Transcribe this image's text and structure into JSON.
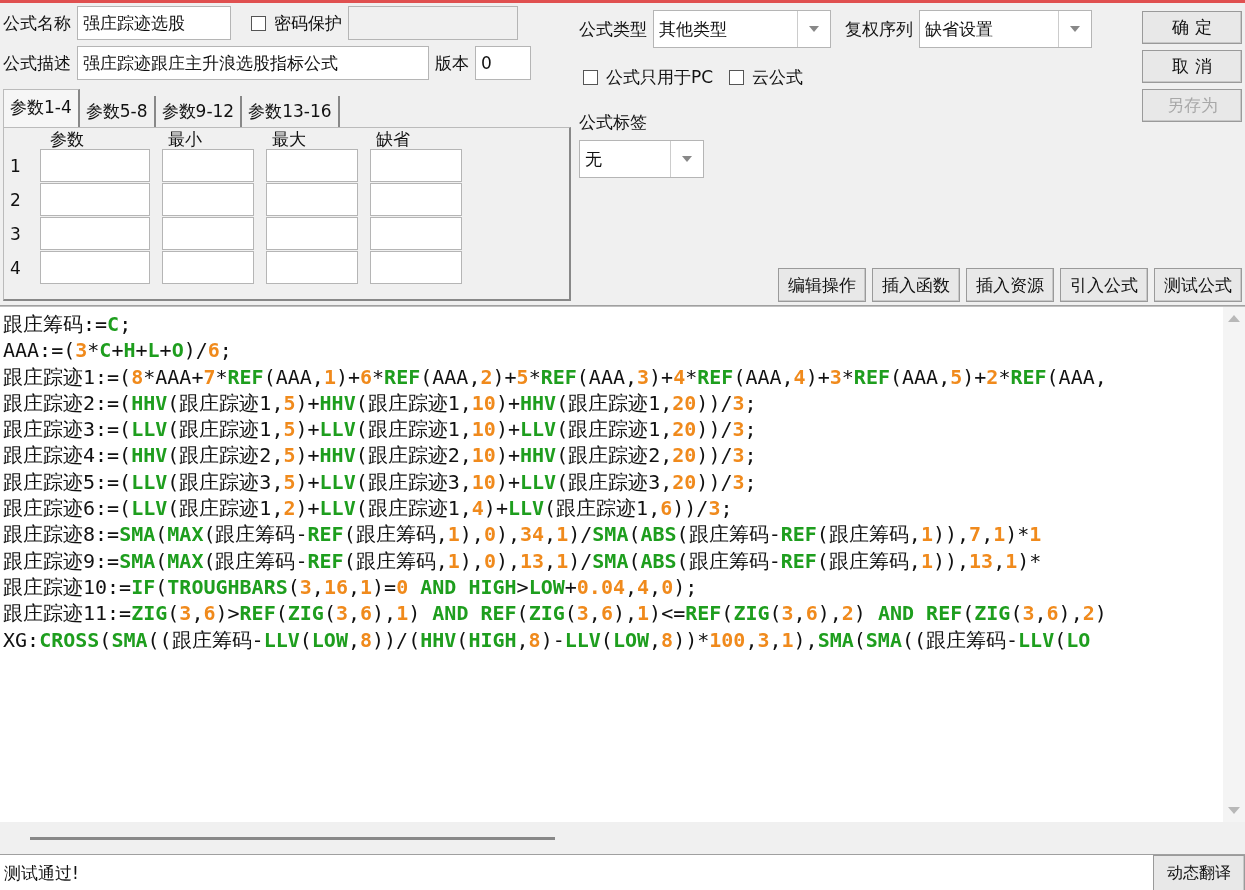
{
  "header": {
    "name": {
      "label": "公式名称",
      "value": "强庄踪迹选股"
    },
    "password": {
      "label": "密码保护",
      "checked": false
    },
    "description": {
      "label": "公式描述",
      "value": "强庄踪迹跟庄主升浪选股指标公式"
    },
    "version": {
      "label": "版本",
      "value": "0"
    },
    "formula_type": {
      "label": "公式类型",
      "value": "其他类型"
    },
    "adjust_series": {
      "label": "复权序列",
      "value": "缺省设置"
    },
    "pc_only": {
      "label": "公式只用于PC",
      "checked": false
    },
    "cloud": {
      "label": "云公式",
      "checked": false
    },
    "tag": {
      "label": "公式标签",
      "value": "无"
    }
  },
  "side_buttons": [
    {
      "label": "确 定",
      "disabled": false
    },
    {
      "label": "取 消",
      "disabled": false
    },
    {
      "label": "另存为",
      "disabled": true
    }
  ],
  "tabs": [
    {
      "label": "参数1-4",
      "selected": true
    },
    {
      "label": "参数5-8",
      "selected": false
    },
    {
      "label": "参数9-12",
      "selected": false
    },
    {
      "label": "参数13-16",
      "selected": false
    }
  ],
  "param_table": {
    "columns": [
      "参数",
      "最小",
      "最大",
      "缺省"
    ],
    "rows": [
      "1",
      "2",
      "3",
      "4"
    ]
  },
  "tool_buttons": [
    "编辑操作",
    "插入函数",
    "插入资源",
    "引入公式",
    "测试公式"
  ],
  "code_lines": [
    [
      {
        "kind": "plain",
        "text": "跟庄筹码:="
      },
      {
        "kind": "fn",
        "text": "C"
      },
      {
        "kind": "plain",
        "text": ";"
      }
    ],
    [
      {
        "kind": "plain",
        "text": "AAA:=("
      },
      {
        "kind": "num",
        "text": "3"
      },
      {
        "kind": "plain",
        "text": "*"
      },
      {
        "kind": "fn",
        "text": "C"
      },
      {
        "kind": "plain",
        "text": "+"
      },
      {
        "kind": "fn",
        "text": "H"
      },
      {
        "kind": "plain",
        "text": "+"
      },
      {
        "kind": "fn",
        "text": "L"
      },
      {
        "kind": "plain",
        "text": "+"
      },
      {
        "kind": "fn",
        "text": "O"
      },
      {
        "kind": "plain",
        "text": ")/"
      },
      {
        "kind": "num",
        "text": "6"
      },
      {
        "kind": "plain",
        "text": ";"
      }
    ],
    [
      {
        "kind": "plain",
        "text": "跟庄踪迹1:=("
      },
      {
        "kind": "num",
        "text": "8"
      },
      {
        "kind": "plain",
        "text": "*AAA+"
      },
      {
        "kind": "num",
        "text": "7"
      },
      {
        "kind": "plain",
        "text": "*"
      },
      {
        "kind": "fn",
        "text": "REF"
      },
      {
        "kind": "plain",
        "text": "(AAA,"
      },
      {
        "kind": "num",
        "text": "1"
      },
      {
        "kind": "plain",
        "text": ")+"
      },
      {
        "kind": "num",
        "text": "6"
      },
      {
        "kind": "plain",
        "text": "*"
      },
      {
        "kind": "fn",
        "text": "REF"
      },
      {
        "kind": "plain",
        "text": "(AAA,"
      },
      {
        "kind": "num",
        "text": "2"
      },
      {
        "kind": "plain",
        "text": ")+"
      },
      {
        "kind": "num",
        "text": "5"
      },
      {
        "kind": "plain",
        "text": "*"
      },
      {
        "kind": "fn",
        "text": "REF"
      },
      {
        "kind": "plain",
        "text": "(AAA,"
      },
      {
        "kind": "num",
        "text": "3"
      },
      {
        "kind": "plain",
        "text": ")+"
      },
      {
        "kind": "num",
        "text": "4"
      },
      {
        "kind": "plain",
        "text": "*"
      },
      {
        "kind": "fn",
        "text": "REF"
      },
      {
        "kind": "plain",
        "text": "(AAA,"
      },
      {
        "kind": "num",
        "text": "4"
      },
      {
        "kind": "plain",
        "text": ")+"
      },
      {
        "kind": "num",
        "text": "3"
      },
      {
        "kind": "plain",
        "text": "*"
      },
      {
        "kind": "fn",
        "text": "REF"
      },
      {
        "kind": "plain",
        "text": "(AAA,"
      },
      {
        "kind": "num",
        "text": "5"
      },
      {
        "kind": "plain",
        "text": ")+"
      },
      {
        "kind": "num",
        "text": "2"
      },
      {
        "kind": "plain",
        "text": "*"
      },
      {
        "kind": "fn",
        "text": "REF"
      },
      {
        "kind": "plain",
        "text": "(AAA,"
      }
    ],
    [
      {
        "kind": "plain",
        "text": "跟庄踪迹2:=("
      },
      {
        "kind": "fn",
        "text": "HHV"
      },
      {
        "kind": "plain",
        "text": "(跟庄踪迹1,"
      },
      {
        "kind": "num",
        "text": "5"
      },
      {
        "kind": "plain",
        "text": ")+"
      },
      {
        "kind": "fn",
        "text": "HHV"
      },
      {
        "kind": "plain",
        "text": "(跟庄踪迹1,"
      },
      {
        "kind": "num",
        "text": "10"
      },
      {
        "kind": "plain",
        "text": ")+"
      },
      {
        "kind": "fn",
        "text": "HHV"
      },
      {
        "kind": "plain",
        "text": "(跟庄踪迹1,"
      },
      {
        "kind": "num",
        "text": "20"
      },
      {
        "kind": "plain",
        "text": "))/"
      },
      {
        "kind": "num",
        "text": "3"
      },
      {
        "kind": "plain",
        "text": ";"
      }
    ],
    [
      {
        "kind": "plain",
        "text": "跟庄踪迹3:=("
      },
      {
        "kind": "fn",
        "text": "LLV"
      },
      {
        "kind": "plain",
        "text": "(跟庄踪迹1,"
      },
      {
        "kind": "num",
        "text": "5"
      },
      {
        "kind": "plain",
        "text": ")+"
      },
      {
        "kind": "fn",
        "text": "LLV"
      },
      {
        "kind": "plain",
        "text": "(跟庄踪迹1,"
      },
      {
        "kind": "num",
        "text": "10"
      },
      {
        "kind": "plain",
        "text": ")+"
      },
      {
        "kind": "fn",
        "text": "LLV"
      },
      {
        "kind": "plain",
        "text": "(跟庄踪迹1,"
      },
      {
        "kind": "num",
        "text": "20"
      },
      {
        "kind": "plain",
        "text": "))/"
      },
      {
        "kind": "num",
        "text": "3"
      },
      {
        "kind": "plain",
        "text": ";"
      }
    ],
    [
      {
        "kind": "plain",
        "text": "跟庄踪迹4:=("
      },
      {
        "kind": "fn",
        "text": "HHV"
      },
      {
        "kind": "plain",
        "text": "(跟庄踪迹2,"
      },
      {
        "kind": "num",
        "text": "5"
      },
      {
        "kind": "plain",
        "text": ")+"
      },
      {
        "kind": "fn",
        "text": "HHV"
      },
      {
        "kind": "plain",
        "text": "(跟庄踪迹2,"
      },
      {
        "kind": "num",
        "text": "10"
      },
      {
        "kind": "plain",
        "text": ")+"
      },
      {
        "kind": "fn",
        "text": "HHV"
      },
      {
        "kind": "plain",
        "text": "(跟庄踪迹2,"
      },
      {
        "kind": "num",
        "text": "20"
      },
      {
        "kind": "plain",
        "text": "))/"
      },
      {
        "kind": "num",
        "text": "3"
      },
      {
        "kind": "plain",
        "text": ";"
      }
    ],
    [
      {
        "kind": "plain",
        "text": "跟庄踪迹5:=("
      },
      {
        "kind": "fn",
        "text": "LLV"
      },
      {
        "kind": "plain",
        "text": "(跟庄踪迹3,"
      },
      {
        "kind": "num",
        "text": "5"
      },
      {
        "kind": "plain",
        "text": ")+"
      },
      {
        "kind": "fn",
        "text": "LLV"
      },
      {
        "kind": "plain",
        "text": "(跟庄踪迹3,"
      },
      {
        "kind": "num",
        "text": "10"
      },
      {
        "kind": "plain",
        "text": ")+"
      },
      {
        "kind": "fn",
        "text": "LLV"
      },
      {
        "kind": "plain",
        "text": "(跟庄踪迹3,"
      },
      {
        "kind": "num",
        "text": "20"
      },
      {
        "kind": "plain",
        "text": "))/"
      },
      {
        "kind": "num",
        "text": "3"
      },
      {
        "kind": "plain",
        "text": ";"
      }
    ],
    [
      {
        "kind": "plain",
        "text": "跟庄踪迹6:=("
      },
      {
        "kind": "fn",
        "text": "LLV"
      },
      {
        "kind": "plain",
        "text": "(跟庄踪迹1,"
      },
      {
        "kind": "num",
        "text": "2"
      },
      {
        "kind": "plain",
        "text": ")+"
      },
      {
        "kind": "fn",
        "text": "LLV"
      },
      {
        "kind": "plain",
        "text": "(跟庄踪迹1,"
      },
      {
        "kind": "num",
        "text": "4"
      },
      {
        "kind": "plain",
        "text": ")+"
      },
      {
        "kind": "fn",
        "text": "LLV"
      },
      {
        "kind": "plain",
        "text": "(跟庄踪迹1,"
      },
      {
        "kind": "num",
        "text": "6"
      },
      {
        "kind": "plain",
        "text": "))/"
      },
      {
        "kind": "num",
        "text": "3"
      },
      {
        "kind": "plain",
        "text": ";"
      }
    ],
    [
      {
        "kind": "plain",
        "text": "跟庄踪迹8:="
      },
      {
        "kind": "fn",
        "text": "SMA"
      },
      {
        "kind": "plain",
        "text": "("
      },
      {
        "kind": "fn",
        "text": "MAX"
      },
      {
        "kind": "plain",
        "text": "(跟庄筹码-"
      },
      {
        "kind": "fn",
        "text": "REF"
      },
      {
        "kind": "plain",
        "text": "(跟庄筹码,"
      },
      {
        "kind": "num",
        "text": "1"
      },
      {
        "kind": "plain",
        "text": "),"
      },
      {
        "kind": "num",
        "text": "0"
      },
      {
        "kind": "plain",
        "text": "),"
      },
      {
        "kind": "num",
        "text": "34"
      },
      {
        "kind": "plain",
        "text": ","
      },
      {
        "kind": "num",
        "text": "1"
      },
      {
        "kind": "plain",
        "text": ")/"
      },
      {
        "kind": "fn",
        "text": "SMA"
      },
      {
        "kind": "plain",
        "text": "("
      },
      {
        "kind": "fn",
        "text": "ABS"
      },
      {
        "kind": "plain",
        "text": "(跟庄筹码-"
      },
      {
        "kind": "fn",
        "text": "REF"
      },
      {
        "kind": "plain",
        "text": "(跟庄筹码,"
      },
      {
        "kind": "num",
        "text": "1"
      },
      {
        "kind": "plain",
        "text": ")),"
      },
      {
        "kind": "num",
        "text": "7"
      },
      {
        "kind": "plain",
        "text": ","
      },
      {
        "kind": "num",
        "text": "1"
      },
      {
        "kind": "plain",
        "text": ")*"
      },
      {
        "kind": "num",
        "text": "1"
      }
    ],
    [
      {
        "kind": "plain",
        "text": "跟庄踪迹9:="
      },
      {
        "kind": "fn",
        "text": "SMA"
      },
      {
        "kind": "plain",
        "text": "("
      },
      {
        "kind": "fn",
        "text": "MAX"
      },
      {
        "kind": "plain",
        "text": "(跟庄筹码-"
      },
      {
        "kind": "fn",
        "text": "REF"
      },
      {
        "kind": "plain",
        "text": "(跟庄筹码,"
      },
      {
        "kind": "num",
        "text": "1"
      },
      {
        "kind": "plain",
        "text": "),"
      },
      {
        "kind": "num",
        "text": "0"
      },
      {
        "kind": "plain",
        "text": "),"
      },
      {
        "kind": "num",
        "text": "13"
      },
      {
        "kind": "plain",
        "text": ","
      },
      {
        "kind": "num",
        "text": "1"
      },
      {
        "kind": "plain",
        "text": ")/"
      },
      {
        "kind": "fn",
        "text": "SMA"
      },
      {
        "kind": "plain",
        "text": "("
      },
      {
        "kind": "fn",
        "text": "ABS"
      },
      {
        "kind": "plain",
        "text": "(跟庄筹码-"
      },
      {
        "kind": "fn",
        "text": "REF"
      },
      {
        "kind": "plain",
        "text": "(跟庄筹码,"
      },
      {
        "kind": "num",
        "text": "1"
      },
      {
        "kind": "plain",
        "text": ")),"
      },
      {
        "kind": "num",
        "text": "13"
      },
      {
        "kind": "plain",
        "text": ","
      },
      {
        "kind": "num",
        "text": "1"
      },
      {
        "kind": "plain",
        "text": ")*"
      }
    ],
    [
      {
        "kind": "plain",
        "text": "跟庄踪迹10:="
      },
      {
        "kind": "fn",
        "text": "IF"
      },
      {
        "kind": "plain",
        "text": "("
      },
      {
        "kind": "fn",
        "text": "TROUGHBARS"
      },
      {
        "kind": "plain",
        "text": "("
      },
      {
        "kind": "num",
        "text": "3"
      },
      {
        "kind": "plain",
        "text": ","
      },
      {
        "kind": "num",
        "text": "16"
      },
      {
        "kind": "plain",
        "text": ","
      },
      {
        "kind": "num",
        "text": "1"
      },
      {
        "kind": "plain",
        "text": ")="
      },
      {
        "kind": "num",
        "text": "0"
      },
      {
        "kind": "fn",
        "text": " AND "
      },
      {
        "kind": "fn",
        "text": "HIGH"
      },
      {
        "kind": "plain",
        "text": ">"
      },
      {
        "kind": "fn",
        "text": "LOW"
      },
      {
        "kind": "plain",
        "text": "+"
      },
      {
        "kind": "num",
        "text": "0.04"
      },
      {
        "kind": "plain",
        "text": ","
      },
      {
        "kind": "num",
        "text": "4"
      },
      {
        "kind": "plain",
        "text": ","
      },
      {
        "kind": "num",
        "text": "0"
      },
      {
        "kind": "plain",
        "text": ");"
      }
    ],
    [
      {
        "kind": "plain",
        "text": "跟庄踪迹11:="
      },
      {
        "kind": "fn",
        "text": "ZIG"
      },
      {
        "kind": "plain",
        "text": "("
      },
      {
        "kind": "num",
        "text": "3"
      },
      {
        "kind": "plain",
        "text": ","
      },
      {
        "kind": "num",
        "text": "6"
      },
      {
        "kind": "plain",
        "text": ")>"
      },
      {
        "kind": "fn",
        "text": "REF"
      },
      {
        "kind": "plain",
        "text": "("
      },
      {
        "kind": "fn",
        "text": "ZIG"
      },
      {
        "kind": "plain",
        "text": "("
      },
      {
        "kind": "num",
        "text": "3"
      },
      {
        "kind": "plain",
        "text": ","
      },
      {
        "kind": "num",
        "text": "6"
      },
      {
        "kind": "plain",
        "text": "),"
      },
      {
        "kind": "num",
        "text": "1"
      },
      {
        "kind": "plain",
        "text": ") "
      },
      {
        "kind": "fn",
        "text": "AND "
      },
      {
        "kind": "fn",
        "text": "REF"
      },
      {
        "kind": "plain",
        "text": "("
      },
      {
        "kind": "fn",
        "text": "ZIG"
      },
      {
        "kind": "plain",
        "text": "("
      },
      {
        "kind": "num",
        "text": "3"
      },
      {
        "kind": "plain",
        "text": ","
      },
      {
        "kind": "num",
        "text": "6"
      },
      {
        "kind": "plain",
        "text": "),"
      },
      {
        "kind": "num",
        "text": "1"
      },
      {
        "kind": "plain",
        "text": ")<="
      },
      {
        "kind": "fn",
        "text": "REF"
      },
      {
        "kind": "plain",
        "text": "("
      },
      {
        "kind": "fn",
        "text": "ZIG"
      },
      {
        "kind": "plain",
        "text": "("
      },
      {
        "kind": "num",
        "text": "3"
      },
      {
        "kind": "plain",
        "text": ","
      },
      {
        "kind": "num",
        "text": "6"
      },
      {
        "kind": "plain",
        "text": "),"
      },
      {
        "kind": "num",
        "text": "2"
      },
      {
        "kind": "plain",
        "text": ") "
      },
      {
        "kind": "fn",
        "text": "AND "
      },
      {
        "kind": "fn",
        "text": "REF"
      },
      {
        "kind": "plain",
        "text": "("
      },
      {
        "kind": "fn",
        "text": "ZIG"
      },
      {
        "kind": "plain",
        "text": "("
      },
      {
        "kind": "num",
        "text": "3"
      },
      {
        "kind": "plain",
        "text": ","
      },
      {
        "kind": "num",
        "text": "6"
      },
      {
        "kind": "plain",
        "text": "),"
      },
      {
        "kind": "num",
        "text": "2"
      },
      {
        "kind": "plain",
        "text": ")"
      }
    ],
    [
      {
        "kind": "plain",
        "text": "XG:"
      },
      {
        "kind": "fn",
        "text": "CROSS"
      },
      {
        "kind": "plain",
        "text": "("
      },
      {
        "kind": "fn",
        "text": "SMA"
      },
      {
        "kind": "plain",
        "text": "((跟庄筹码-"
      },
      {
        "kind": "fn",
        "text": "LLV"
      },
      {
        "kind": "plain",
        "text": "("
      },
      {
        "kind": "fn",
        "text": "LOW"
      },
      {
        "kind": "plain",
        "text": ","
      },
      {
        "kind": "num",
        "text": "8"
      },
      {
        "kind": "plain",
        "text": "))/("
      },
      {
        "kind": "fn",
        "text": "HHV"
      },
      {
        "kind": "plain",
        "text": "("
      },
      {
        "kind": "fn",
        "text": "HIGH"
      },
      {
        "kind": "plain",
        "text": ","
      },
      {
        "kind": "num",
        "text": "8"
      },
      {
        "kind": "plain",
        "text": ")-"
      },
      {
        "kind": "fn",
        "text": "LLV"
      },
      {
        "kind": "plain",
        "text": "("
      },
      {
        "kind": "fn",
        "text": "LOW"
      },
      {
        "kind": "plain",
        "text": ","
      },
      {
        "kind": "num",
        "text": "8"
      },
      {
        "kind": "plain",
        "text": "))*"
      },
      {
        "kind": "num",
        "text": "100"
      },
      {
        "kind": "plain",
        "text": ","
      },
      {
        "kind": "num",
        "text": "3"
      },
      {
        "kind": "plain",
        "text": ","
      },
      {
        "kind": "num",
        "text": "1"
      },
      {
        "kind": "plain",
        "text": "),"
      },
      {
        "kind": "fn",
        "text": "SMA"
      },
      {
        "kind": "plain",
        "text": "("
      },
      {
        "kind": "fn",
        "text": "SMA"
      },
      {
        "kind": "plain",
        "text": "((跟庄筹码-"
      },
      {
        "kind": "fn",
        "text": "LLV"
      },
      {
        "kind": "plain",
        "text": "("
      },
      {
        "kind": "fn",
        "text": "LO"
      }
    ]
  ],
  "status_bar": {
    "message": "测试通过!",
    "button": "动态翻译"
  }
}
